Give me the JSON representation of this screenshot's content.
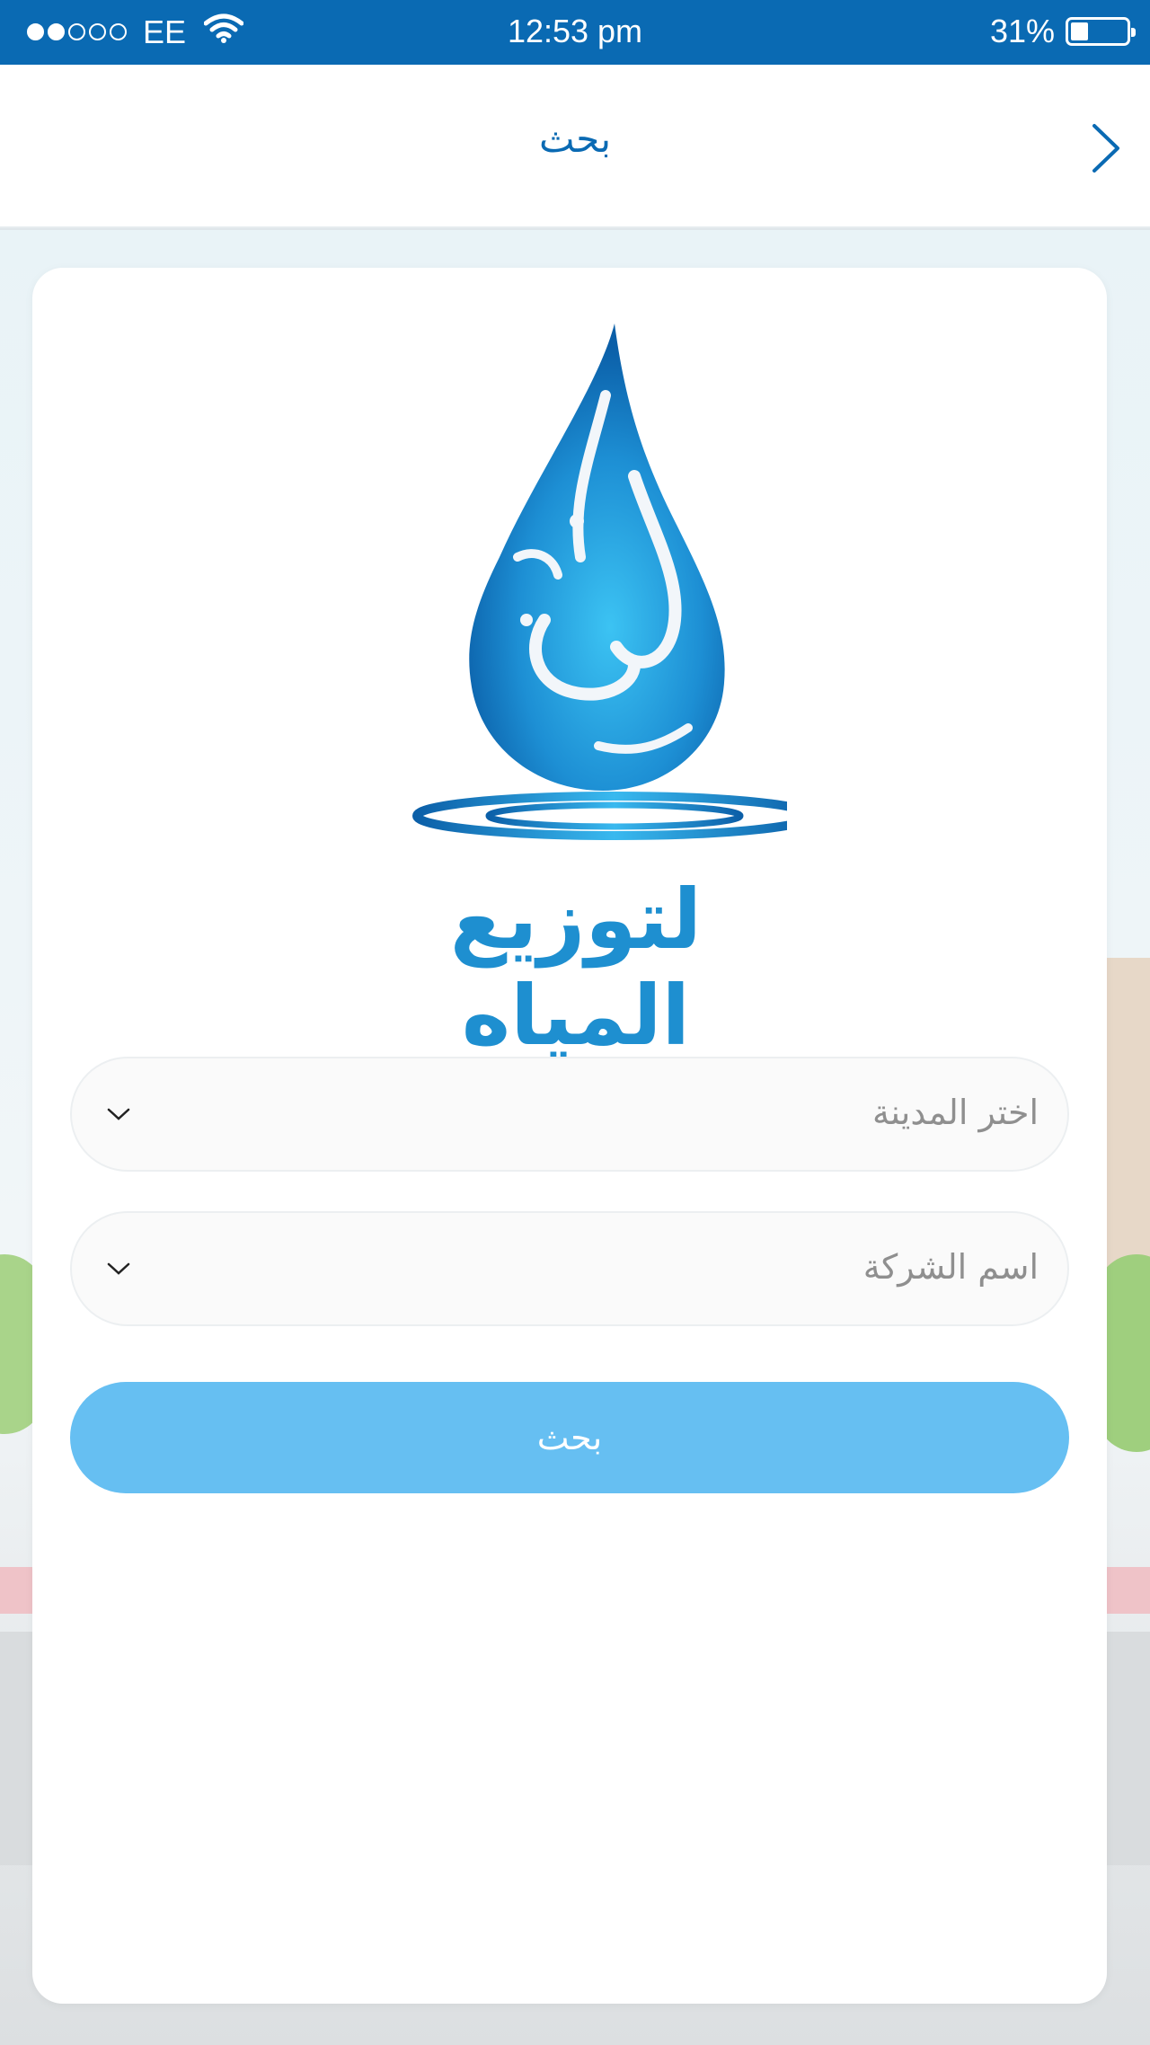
{
  "status_bar": {
    "carrier": "EE",
    "time": "12:53 pm",
    "battery": "31%",
    "battery_level": 0.31,
    "signal_filled": 2,
    "signal_total": 5
  },
  "nav": {
    "title": "بحث"
  },
  "logo": {
    "text": "لتوزيع المياه",
    "icon": "water-drop-logo"
  },
  "form": {
    "city_placeholder": "اختر المدينة",
    "company_placeholder": "اسم الشركة",
    "search_label": "بحث"
  },
  "colors": {
    "primary": "#0a6ab3",
    "button": "#66bff2",
    "logo_blue": "#1e8fd0"
  }
}
